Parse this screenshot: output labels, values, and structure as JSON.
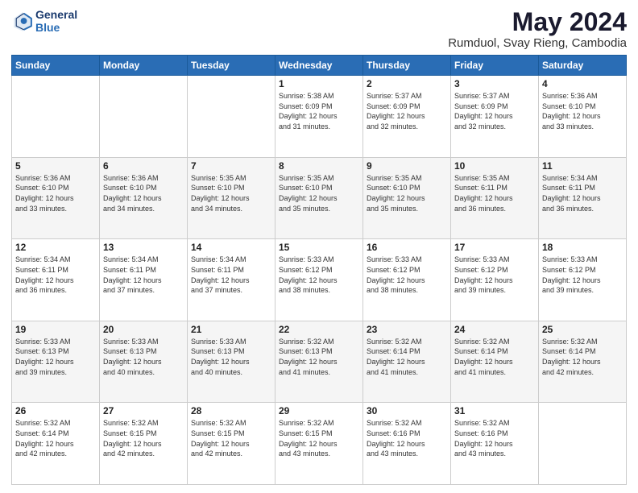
{
  "header": {
    "logo_line1": "General",
    "logo_line2": "Blue",
    "title": "May 2024",
    "subtitle": "Rumduol, Svay Rieng, Cambodia"
  },
  "calendar": {
    "days_of_week": [
      "Sunday",
      "Monday",
      "Tuesday",
      "Wednesday",
      "Thursday",
      "Friday",
      "Saturday"
    ],
    "weeks": [
      [
        {
          "day": "",
          "info": ""
        },
        {
          "day": "",
          "info": ""
        },
        {
          "day": "",
          "info": ""
        },
        {
          "day": "1",
          "info": "Sunrise: 5:38 AM\nSunset: 6:09 PM\nDaylight: 12 hours\nand 31 minutes."
        },
        {
          "day": "2",
          "info": "Sunrise: 5:37 AM\nSunset: 6:09 PM\nDaylight: 12 hours\nand 32 minutes."
        },
        {
          "day": "3",
          "info": "Sunrise: 5:37 AM\nSunset: 6:09 PM\nDaylight: 12 hours\nand 32 minutes."
        },
        {
          "day": "4",
          "info": "Sunrise: 5:36 AM\nSunset: 6:10 PM\nDaylight: 12 hours\nand 33 minutes."
        }
      ],
      [
        {
          "day": "5",
          "info": "Sunrise: 5:36 AM\nSunset: 6:10 PM\nDaylight: 12 hours\nand 33 minutes."
        },
        {
          "day": "6",
          "info": "Sunrise: 5:36 AM\nSunset: 6:10 PM\nDaylight: 12 hours\nand 34 minutes."
        },
        {
          "day": "7",
          "info": "Sunrise: 5:35 AM\nSunset: 6:10 PM\nDaylight: 12 hours\nand 34 minutes."
        },
        {
          "day": "8",
          "info": "Sunrise: 5:35 AM\nSunset: 6:10 PM\nDaylight: 12 hours\nand 35 minutes."
        },
        {
          "day": "9",
          "info": "Sunrise: 5:35 AM\nSunset: 6:10 PM\nDaylight: 12 hours\nand 35 minutes."
        },
        {
          "day": "10",
          "info": "Sunrise: 5:35 AM\nSunset: 6:11 PM\nDaylight: 12 hours\nand 36 minutes."
        },
        {
          "day": "11",
          "info": "Sunrise: 5:34 AM\nSunset: 6:11 PM\nDaylight: 12 hours\nand 36 minutes."
        }
      ],
      [
        {
          "day": "12",
          "info": "Sunrise: 5:34 AM\nSunset: 6:11 PM\nDaylight: 12 hours\nand 36 minutes."
        },
        {
          "day": "13",
          "info": "Sunrise: 5:34 AM\nSunset: 6:11 PM\nDaylight: 12 hours\nand 37 minutes."
        },
        {
          "day": "14",
          "info": "Sunrise: 5:34 AM\nSunset: 6:11 PM\nDaylight: 12 hours\nand 37 minutes."
        },
        {
          "day": "15",
          "info": "Sunrise: 5:33 AM\nSunset: 6:12 PM\nDaylight: 12 hours\nand 38 minutes."
        },
        {
          "day": "16",
          "info": "Sunrise: 5:33 AM\nSunset: 6:12 PM\nDaylight: 12 hours\nand 38 minutes."
        },
        {
          "day": "17",
          "info": "Sunrise: 5:33 AM\nSunset: 6:12 PM\nDaylight: 12 hours\nand 39 minutes."
        },
        {
          "day": "18",
          "info": "Sunrise: 5:33 AM\nSunset: 6:12 PM\nDaylight: 12 hours\nand 39 minutes."
        }
      ],
      [
        {
          "day": "19",
          "info": "Sunrise: 5:33 AM\nSunset: 6:13 PM\nDaylight: 12 hours\nand 39 minutes."
        },
        {
          "day": "20",
          "info": "Sunrise: 5:33 AM\nSunset: 6:13 PM\nDaylight: 12 hours\nand 40 minutes."
        },
        {
          "day": "21",
          "info": "Sunrise: 5:33 AM\nSunset: 6:13 PM\nDaylight: 12 hours\nand 40 minutes."
        },
        {
          "day": "22",
          "info": "Sunrise: 5:32 AM\nSunset: 6:13 PM\nDaylight: 12 hours\nand 41 minutes."
        },
        {
          "day": "23",
          "info": "Sunrise: 5:32 AM\nSunset: 6:14 PM\nDaylight: 12 hours\nand 41 minutes."
        },
        {
          "day": "24",
          "info": "Sunrise: 5:32 AM\nSunset: 6:14 PM\nDaylight: 12 hours\nand 41 minutes."
        },
        {
          "day": "25",
          "info": "Sunrise: 5:32 AM\nSunset: 6:14 PM\nDaylight: 12 hours\nand 42 minutes."
        }
      ],
      [
        {
          "day": "26",
          "info": "Sunrise: 5:32 AM\nSunset: 6:14 PM\nDaylight: 12 hours\nand 42 minutes."
        },
        {
          "day": "27",
          "info": "Sunrise: 5:32 AM\nSunset: 6:15 PM\nDaylight: 12 hours\nand 42 minutes."
        },
        {
          "day": "28",
          "info": "Sunrise: 5:32 AM\nSunset: 6:15 PM\nDaylight: 12 hours\nand 42 minutes."
        },
        {
          "day": "29",
          "info": "Sunrise: 5:32 AM\nSunset: 6:15 PM\nDaylight: 12 hours\nand 43 minutes."
        },
        {
          "day": "30",
          "info": "Sunrise: 5:32 AM\nSunset: 6:16 PM\nDaylight: 12 hours\nand 43 minutes."
        },
        {
          "day": "31",
          "info": "Sunrise: 5:32 AM\nSunset: 6:16 PM\nDaylight: 12 hours\nand 43 minutes."
        },
        {
          "day": "",
          "info": ""
        }
      ]
    ]
  }
}
